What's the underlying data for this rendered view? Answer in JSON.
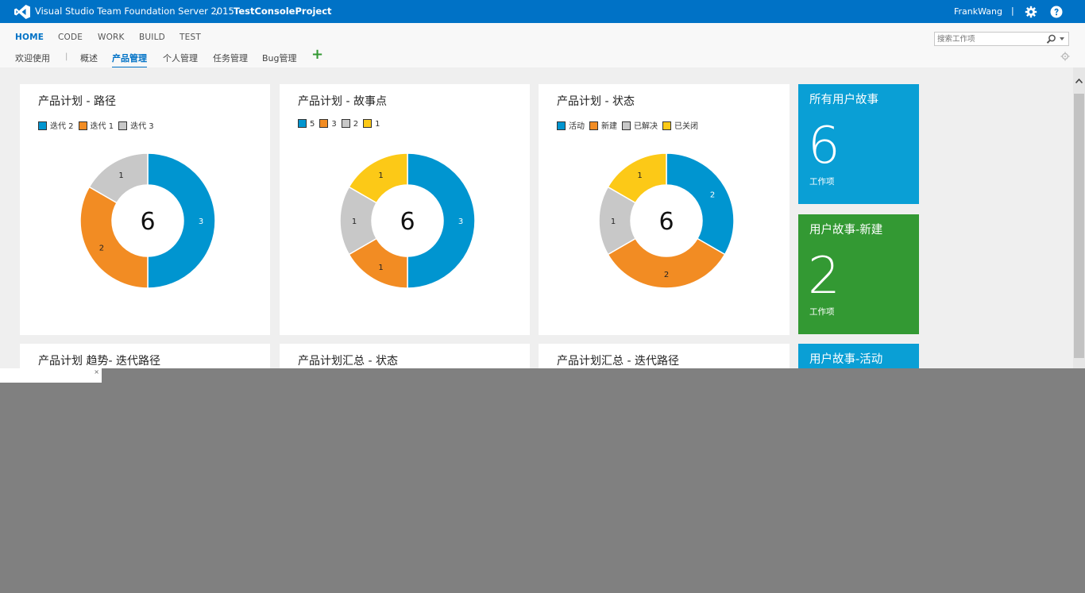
{
  "header": {
    "product": "Visual Studio Team Foundation Server 2015",
    "separator": "/",
    "project": "TestConsoleProject",
    "user": "FrankWang",
    "user_separator": "|"
  },
  "hubs": [
    {
      "label": "HOME",
      "active": true
    },
    {
      "label": "CODE"
    },
    {
      "label": "WORK"
    },
    {
      "label": "BUILD"
    },
    {
      "label": "TEST"
    }
  ],
  "tabs": [
    {
      "label": "欢迎使用"
    },
    {
      "label": "概述"
    },
    {
      "label": "产品管理",
      "active": true
    },
    {
      "label": "个人管理"
    },
    {
      "label": "任务管理"
    },
    {
      "label": "Bug管理"
    }
  ],
  "tab_divider": "|",
  "add_tab": "+",
  "search": {
    "placeholder": "搜索工作项"
  },
  "colors": {
    "topbar": "#0072c6",
    "blue": "#0095d0",
    "orange": "#f28c23",
    "gray": "#c8c8c8",
    "yellow": "#fcc917",
    "tile_blue": "#0a9fd5",
    "tile_green": "#339933"
  },
  "widgets": [
    {
      "title": "产品计划 - 路径",
      "legend": [
        {
          "label": "迭代 2",
          "color": "#0095d0"
        },
        {
          "label": "迭代 1",
          "color": "#f28c23"
        },
        {
          "label": "迭代 3",
          "color": "#c8c8c8"
        }
      ],
      "total": "6",
      "slices": [
        {
          "label": "3",
          "value": 3,
          "color": "#0095d0"
        },
        {
          "label": "2",
          "value": 2,
          "color": "#f28c23"
        },
        {
          "label": "1",
          "value": 1,
          "color": "#c8c8c8"
        }
      ]
    },
    {
      "title": "产品计划 - 故事点",
      "legend": [
        {
          "label": "5",
          "color": "#0095d0"
        },
        {
          "label": "3",
          "color": "#f28c23"
        },
        {
          "label": "2",
          "color": "#c8c8c8"
        },
        {
          "label": "1",
          "color": "#fcc917"
        }
      ],
      "total": "6",
      "slices": [
        {
          "label": "3",
          "value": 3,
          "color": "#0095d0"
        },
        {
          "label": "1",
          "value": 1,
          "color": "#f28c23"
        },
        {
          "label": "1",
          "value": 1,
          "color": "#c8c8c8"
        },
        {
          "label": "1",
          "value": 1,
          "color": "#fcc917"
        }
      ]
    },
    {
      "title": "产品计划 - 状态",
      "legend": [
        {
          "label": "活动",
          "color": "#0095d0"
        },
        {
          "label": "新建",
          "color": "#f28c23"
        },
        {
          "label": "已解决",
          "color": "#c8c8c8"
        },
        {
          "label": "已关闭",
          "color": "#fcc917"
        }
      ],
      "total": "6",
      "slices": [
        {
          "label": "2",
          "value": 2,
          "color": "#0095d0"
        },
        {
          "label": "2",
          "value": 2,
          "color": "#f28c23"
        },
        {
          "label": "1",
          "value": 1,
          "color": "#c8c8c8"
        },
        {
          "label": "1",
          "value": 1,
          "color": "#fcc917"
        }
      ]
    },
    {
      "title": "产品计划 趋势- 迭代路径"
    },
    {
      "title": "产品计划汇总 - 状态"
    },
    {
      "title": "产品计划汇总 - 迭代路径"
    }
  ],
  "tiles": [
    {
      "title": "所有用户故事",
      "count": "6",
      "unit": "工作项",
      "color": "#0a9fd5"
    },
    {
      "title": "用户故事-新建",
      "count": "2",
      "unit": "工作项",
      "color": "#339933"
    },
    {
      "title": "用户故事-活动",
      "color": "#0a9fd5"
    }
  ],
  "popup": {
    "close": "×"
  }
}
